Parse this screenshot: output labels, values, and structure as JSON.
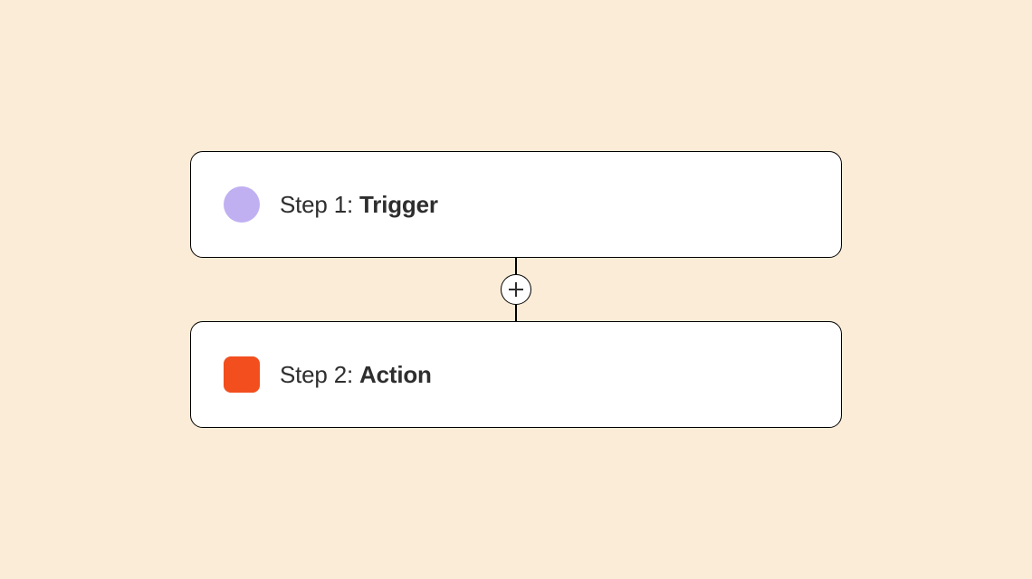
{
  "steps": [
    {
      "prefix": "Step 1: ",
      "title": "Trigger",
      "icon_shape": "circle",
      "icon_color": "#c0b0f2"
    },
    {
      "prefix": "Step 2: ",
      "title": "Action",
      "icon_shape": "square",
      "icon_color": "#f24e1e"
    }
  ],
  "connector": {
    "icon": "plus"
  },
  "colors": {
    "background": "#fbecd7",
    "card_bg": "#ffffff",
    "border": "#000000",
    "text": "#2e2e2e"
  }
}
